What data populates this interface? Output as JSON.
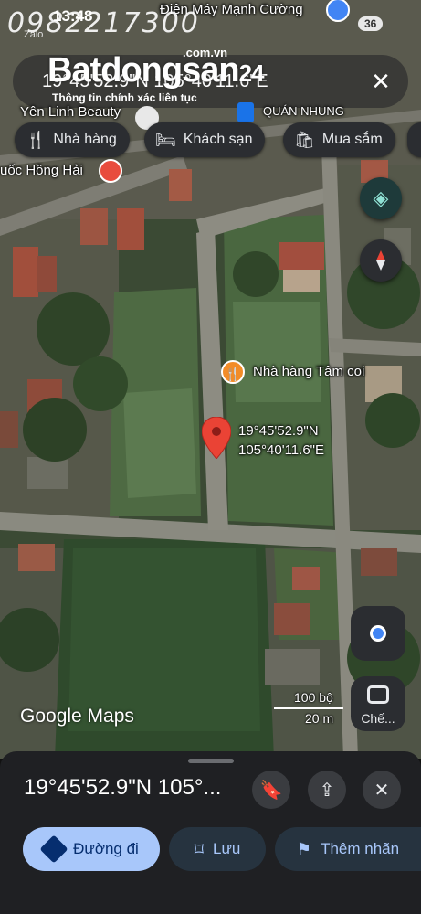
{
  "status": {
    "time": "13:48",
    "app_indicator": "Zalo",
    "battery": "36",
    "top_place": "Điện Máy Mạnh Cường"
  },
  "watermark": {
    "phone": "0982217300",
    "brand": "Batdongsan",
    "brand_suffix": "24",
    "domain": ".com.vn",
    "tagline": "Thông tin chính xác liên tục"
  },
  "search": {
    "query": "19°45'52.9\"N 105°40'11.6\"E"
  },
  "chips": [
    {
      "label": "Nhà hàng",
      "icon": "restaurant-icon"
    },
    {
      "label": "Khách sạn",
      "icon": "hotel-icon"
    },
    {
      "label": "Mua sắm",
      "icon": "shopping-icon"
    }
  ],
  "places": {
    "beauty": "Yên Linh Beauty",
    "hong_hai": "uốc Hồng Hải",
    "quan_nhung": "QUÁN NHUNG",
    "restaurant": "Nhà hàng Tâm coi"
  },
  "pin": {
    "lat": "19°45'52.9\"N",
    "lng": "105°40'11.6\"E"
  },
  "scale": {
    "imperial": "100 bộ",
    "metric": "20 m"
  },
  "lens": {
    "label": "Chế..."
  },
  "attribution": "Google Maps",
  "sheet": {
    "title": "19°45'52.9\"N 105°...",
    "actions": [
      {
        "label": "Đường đi",
        "icon": "directions-icon"
      },
      {
        "label": "Lưu",
        "icon": "bookmark-icon"
      },
      {
        "label": "Thêm nhãn",
        "icon": "flag-icon"
      }
    ]
  },
  "colors": {
    "accent": "#a8c7fa",
    "pin": "#ea4335",
    "panel": "#1f2023"
  }
}
